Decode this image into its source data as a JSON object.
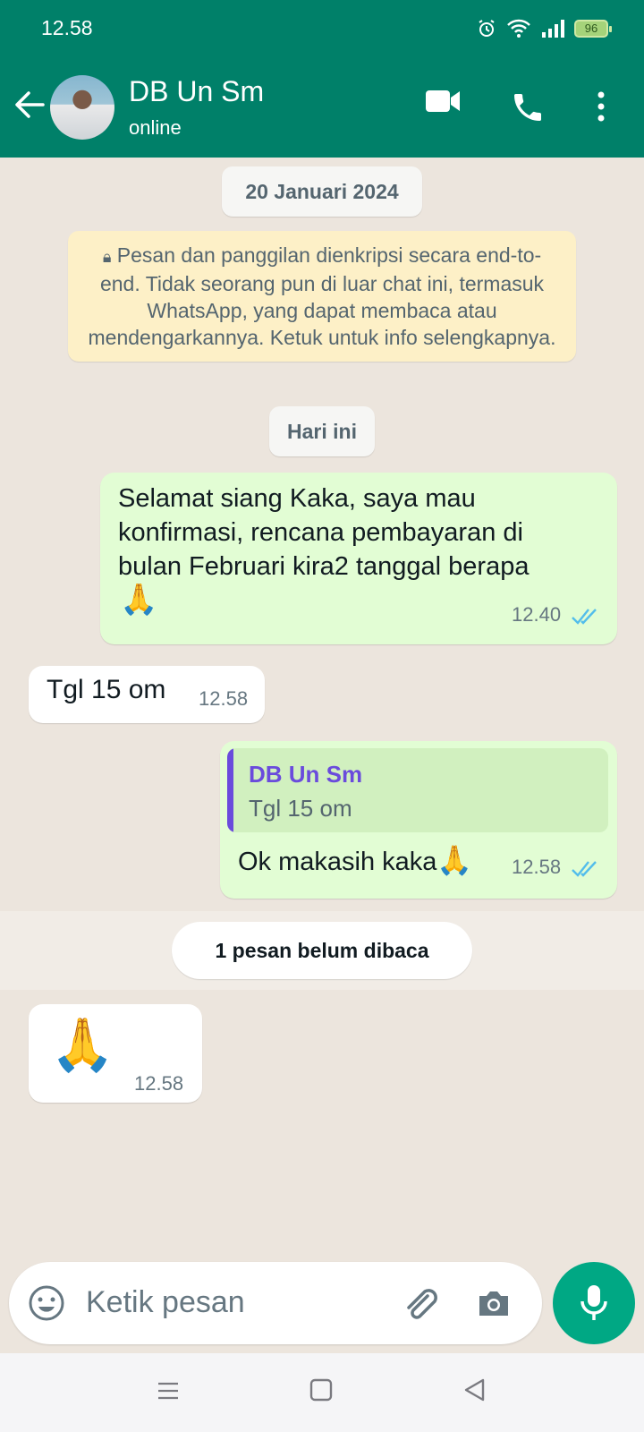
{
  "status_bar": {
    "time": "12.58",
    "battery": "96"
  },
  "header": {
    "contact_name": "DB Un Sm",
    "contact_status": "online"
  },
  "chat": {
    "date_pill": "20 Januari 2024",
    "encryption_notice": "Pesan dan panggilan dienkripsi secara end-to-end. Tidak seorang pun di luar chat ini, termasuk WhatsApp, yang dapat membaca atau mendengarkannya. Ketuk untuk info selengkapnya.",
    "today_pill": "Hari ini",
    "messages": [
      {
        "dir": "out",
        "text": "Selamat siang Kaka, saya mau konfirmasi, rencana pembayaran di bulan Februari kira2 tanggal berapa",
        "emoji": "🙏",
        "time": "12.40"
      },
      {
        "dir": "in",
        "text": "Tgl 15 om",
        "time": "12.58"
      },
      {
        "dir": "out",
        "reply_name": "DB Un Sm",
        "reply_text": "Tgl 15 om",
        "text": "Ok makasih kaka",
        "emoji": "🙏",
        "time": "12.58"
      },
      {
        "dir": "in",
        "emoji": "🙏",
        "time": "12.58"
      }
    ],
    "unread_label": "1 pesan belum dibaca"
  },
  "composer": {
    "placeholder": "Ketik pesan"
  },
  "colors": {
    "header": "#008069",
    "accent": "#00a884",
    "out_bubble": "#e2fdd4",
    "read_ticks": "#53bdeb"
  }
}
